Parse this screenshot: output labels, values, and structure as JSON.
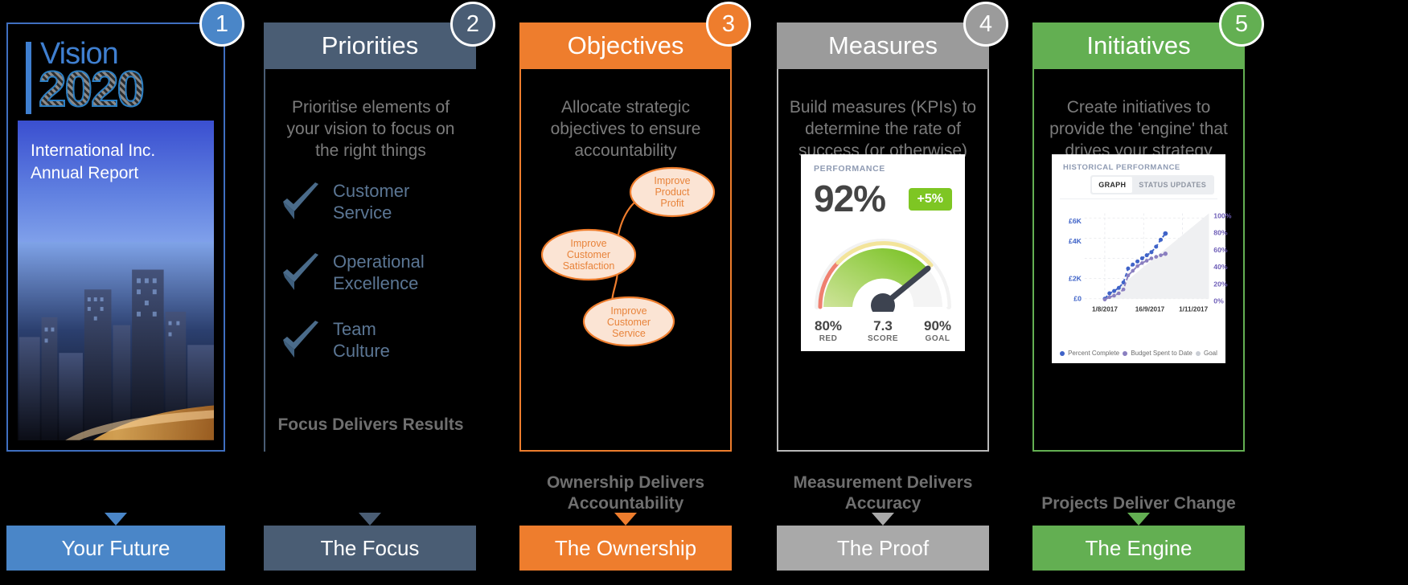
{
  "columns": [
    {
      "number": "1",
      "accent": "#4a86c8",
      "title": "",
      "blurb": "",
      "tagline": "",
      "footer": "Your Future",
      "vision": {
        "word": "Vision",
        "year": "2020",
        "cover_title_line1": "International Inc.",
        "cover_title_line2": "Annual Report"
      }
    },
    {
      "number": "2",
      "accent": "#4a5d74",
      "title": "Priorities",
      "blurb": "Prioritise elements of your vision to focus on the right things",
      "tagline": "Focus Delivers Results",
      "footer": "The Focus",
      "checks": [
        {
          "line1": "Customer",
          "line2": "Service"
        },
        {
          "line1": "Operational",
          "line2": "Excellence"
        },
        {
          "line1": "Team",
          "line2": "Culture"
        }
      ]
    },
    {
      "number": "3",
      "accent": "#ee7d2d",
      "title": "Objectives",
      "blurb": "Allocate strategic objectives to ensure accountability",
      "tagline": "Ownership Delivers Accountability",
      "footer": "The Ownership",
      "objectives": [
        {
          "lines": [
            "Improve",
            "Product",
            "Profit"
          ]
        },
        {
          "lines": [
            "Improve",
            "Customer",
            "Satisfaction"
          ]
        },
        {
          "lines": [
            "Improve",
            "Customer",
            "Service"
          ]
        }
      ]
    },
    {
      "number": "4",
      "accent": "#9b9b9b",
      "title": "Measures",
      "blurb": "Build measures (KPIs) to determine the rate of success (or otherwise)",
      "tagline": "Measurement Delivers Accuracy",
      "footer": "The Proof",
      "kpi": {
        "eyebrow": "PERFORMANCE",
        "value": "92%",
        "delta": "+5%",
        "stats": [
          {
            "value": "80%",
            "label": "RED"
          },
          {
            "value": "7.3",
            "label": "SCORE"
          },
          {
            "value": "90%",
            "label": "GOAL"
          }
        ]
      }
    },
    {
      "number": "5",
      "accent": "#63af52",
      "title": "Initiatives",
      "blurb": "Create initiatives to provide the 'engine' that drives your strategy",
      "tagline": "Projects Deliver Change",
      "footer": "The Engine",
      "history": {
        "eyebrow": "HISTORICAL PERFORMANCE",
        "tabs": [
          {
            "label": "GRAPH",
            "active": true
          },
          {
            "label": "STATUS UPDATES",
            "active": false
          }
        ]
      }
    }
  ],
  "chart_data": {
    "type": "line",
    "title": "HISTORICAL PERFORMANCE",
    "xlabel": "",
    "ylabel": "",
    "grid": true,
    "legend_position": "bottom",
    "x": [
      "1/8/2017",
      "16/9/2017",
      "1/11/2017"
    ],
    "xtick_labels": [
      "1/8/2017",
      "16/9/2017",
      "1/11/2017"
    ],
    "left_axis": {
      "ticks": [
        "£0",
        "£2K",
        "£4K",
        "£6K"
      ],
      "values": [
        0,
        2000,
        4000,
        6000
      ],
      "color": "#3f63c8"
    },
    "right_axis": {
      "ticks": [
        "0%",
        "20%",
        "40%",
        "60%",
        "80%",
        "100%"
      ],
      "values": [
        0,
        20,
        40,
        60,
        80,
        100
      ],
      "color": "#6f5fb8"
    },
    "series": [
      {
        "name": "Percent Complete",
        "color": "#3f63c8",
        "axis": "left",
        "values": [
          0,
          180,
          330,
          420,
          600,
          1500,
          1900,
          2100,
          2250,
          2400,
          2600,
          3000,
          3450,
          3950
        ]
      },
      {
        "name": "Budget Spent to Date",
        "color": "#8a7fc0",
        "axis": "right",
        "values": [
          0,
          2,
          5,
          8,
          12,
          25,
          30,
          33,
          36,
          38,
          40,
          42,
          44,
          46
        ]
      },
      {
        "name": "Goal",
        "color": "#c9cdd4",
        "axis": "left",
        "values": [
          0,
          6000
        ]
      }
    ]
  },
  "gauge_data": {
    "type": "gauge",
    "title": "PERFORMANCE",
    "value_label": "92%",
    "score": "7.3",
    "min_label": "80%",
    "max_label": "90%",
    "delta": "+5%",
    "needle_angle_deg": 57,
    "band_colors": [
      "#ef8070",
      "#b6d96a",
      "#7ec623",
      "#f0e08a"
    ]
  }
}
